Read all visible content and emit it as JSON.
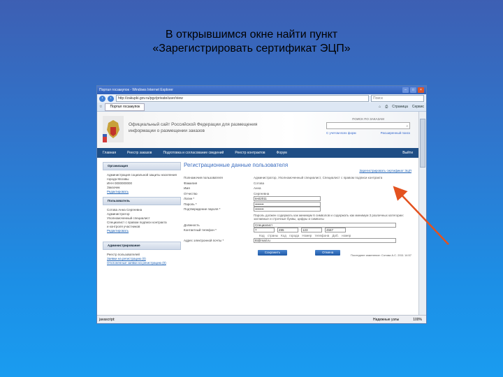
{
  "slide": {
    "title_line1": "В открывшимся окне найти пункт",
    "title_line2": "«Зарегистрировать сертификат ЭЦП»"
  },
  "browser": {
    "window_title": "Портал госзакупок - Windows Internet Explorer",
    "url": "http://zakupki.gov.ru/pgz/private/user/view",
    "search_placeholder": "Поиск",
    "tab_label": "Портал госзакупок",
    "cmd_items": [
      "Страница",
      "Сервис"
    ],
    "status_text": "javascript:",
    "status_zone": "Надежные узлы",
    "status_zoom": "100%"
  },
  "site": {
    "title_line1": "Официальный сайт Российской Федерации для размещения",
    "title_line2": "информации о размещении заказов",
    "search_label": "ПОИСК ПО ЗАКАЗАМ",
    "search_row_left": "С учетом всех форм",
    "search_row_right": "Расширенный поиск",
    "nav": [
      "Главная",
      "Реестр заказов",
      "Подготовка и согласование сведений",
      "Реестр контрактов",
      "Форум",
      "Выйти"
    ]
  },
  "sidebar": {
    "org_header": "Организация",
    "org_body": [
      "Администрация социальной защиты населения",
      "города Москвы",
      "ИНН 0000000000",
      "Заказчик"
    ],
    "org_link": "Редактировать",
    "user_header": "Пользователь",
    "user_body": [
      "Сотова Анна Сергеевна",
      "Администратор",
      "Уполномоченный специалист",
      "Специалист с правом подписи контракта",
      "и контроля участников"
    ],
    "user_link": "Редактировать",
    "admin_header": "Администрирование",
    "admin_body": "Реестр пользователей",
    "admin_link1": "Заявки на регистрацию (0)",
    "admin_link2": "Отклоненные заявки на регистрацию (0)"
  },
  "content": {
    "heading": "Регистрационные данные пользователя",
    "register_link": "Зарегистрировать сертификат ЭЦП",
    "rows": [
      {
        "label": "Полномочия пользователя",
        "value": "Администратор, Уполномоченный специалист, Специалист с правом подписи контракта"
      },
      {
        "label": "Фамилия",
        "value": "Сотова"
      },
      {
        "label": "Имя",
        "value": "Анна"
      },
      {
        "label": "Отчество",
        "value": "Сергеевна"
      }
    ],
    "login_label": "Логин *",
    "login_value": "test2011",
    "password_label": "Пароль *",
    "password_value": "••••••••",
    "confirm_label": "Подтверждение пароля *",
    "confirm_value": "••••••••",
    "password_note": "Пароль должен содержать как минимум 6 символов и содержать как минимум 3 различных категории: заглавные и строчные буквы, цифры и символы",
    "position_label": "Должность",
    "position_value": "Специалист",
    "phone_label": "Контактный телефон *",
    "phone_codes": [
      "7",
      "495",
      "123",
      "4567"
    ],
    "phone_caption": "Код страны  Код города  Номер телефона  Доб. номер",
    "email_label": "Адрес электронной почты *",
    "email_value": "ttt@mail.ru",
    "save_button": "Сохранить",
    "cancel_button": "Отмена",
    "last_change": "Последнее изменение: Сотова А.С. 2011 14:57"
  },
  "colors": {
    "arrow": "#e3521f",
    "nav_bg": "#1f4e85",
    "heading": "#3b6cbf"
  }
}
